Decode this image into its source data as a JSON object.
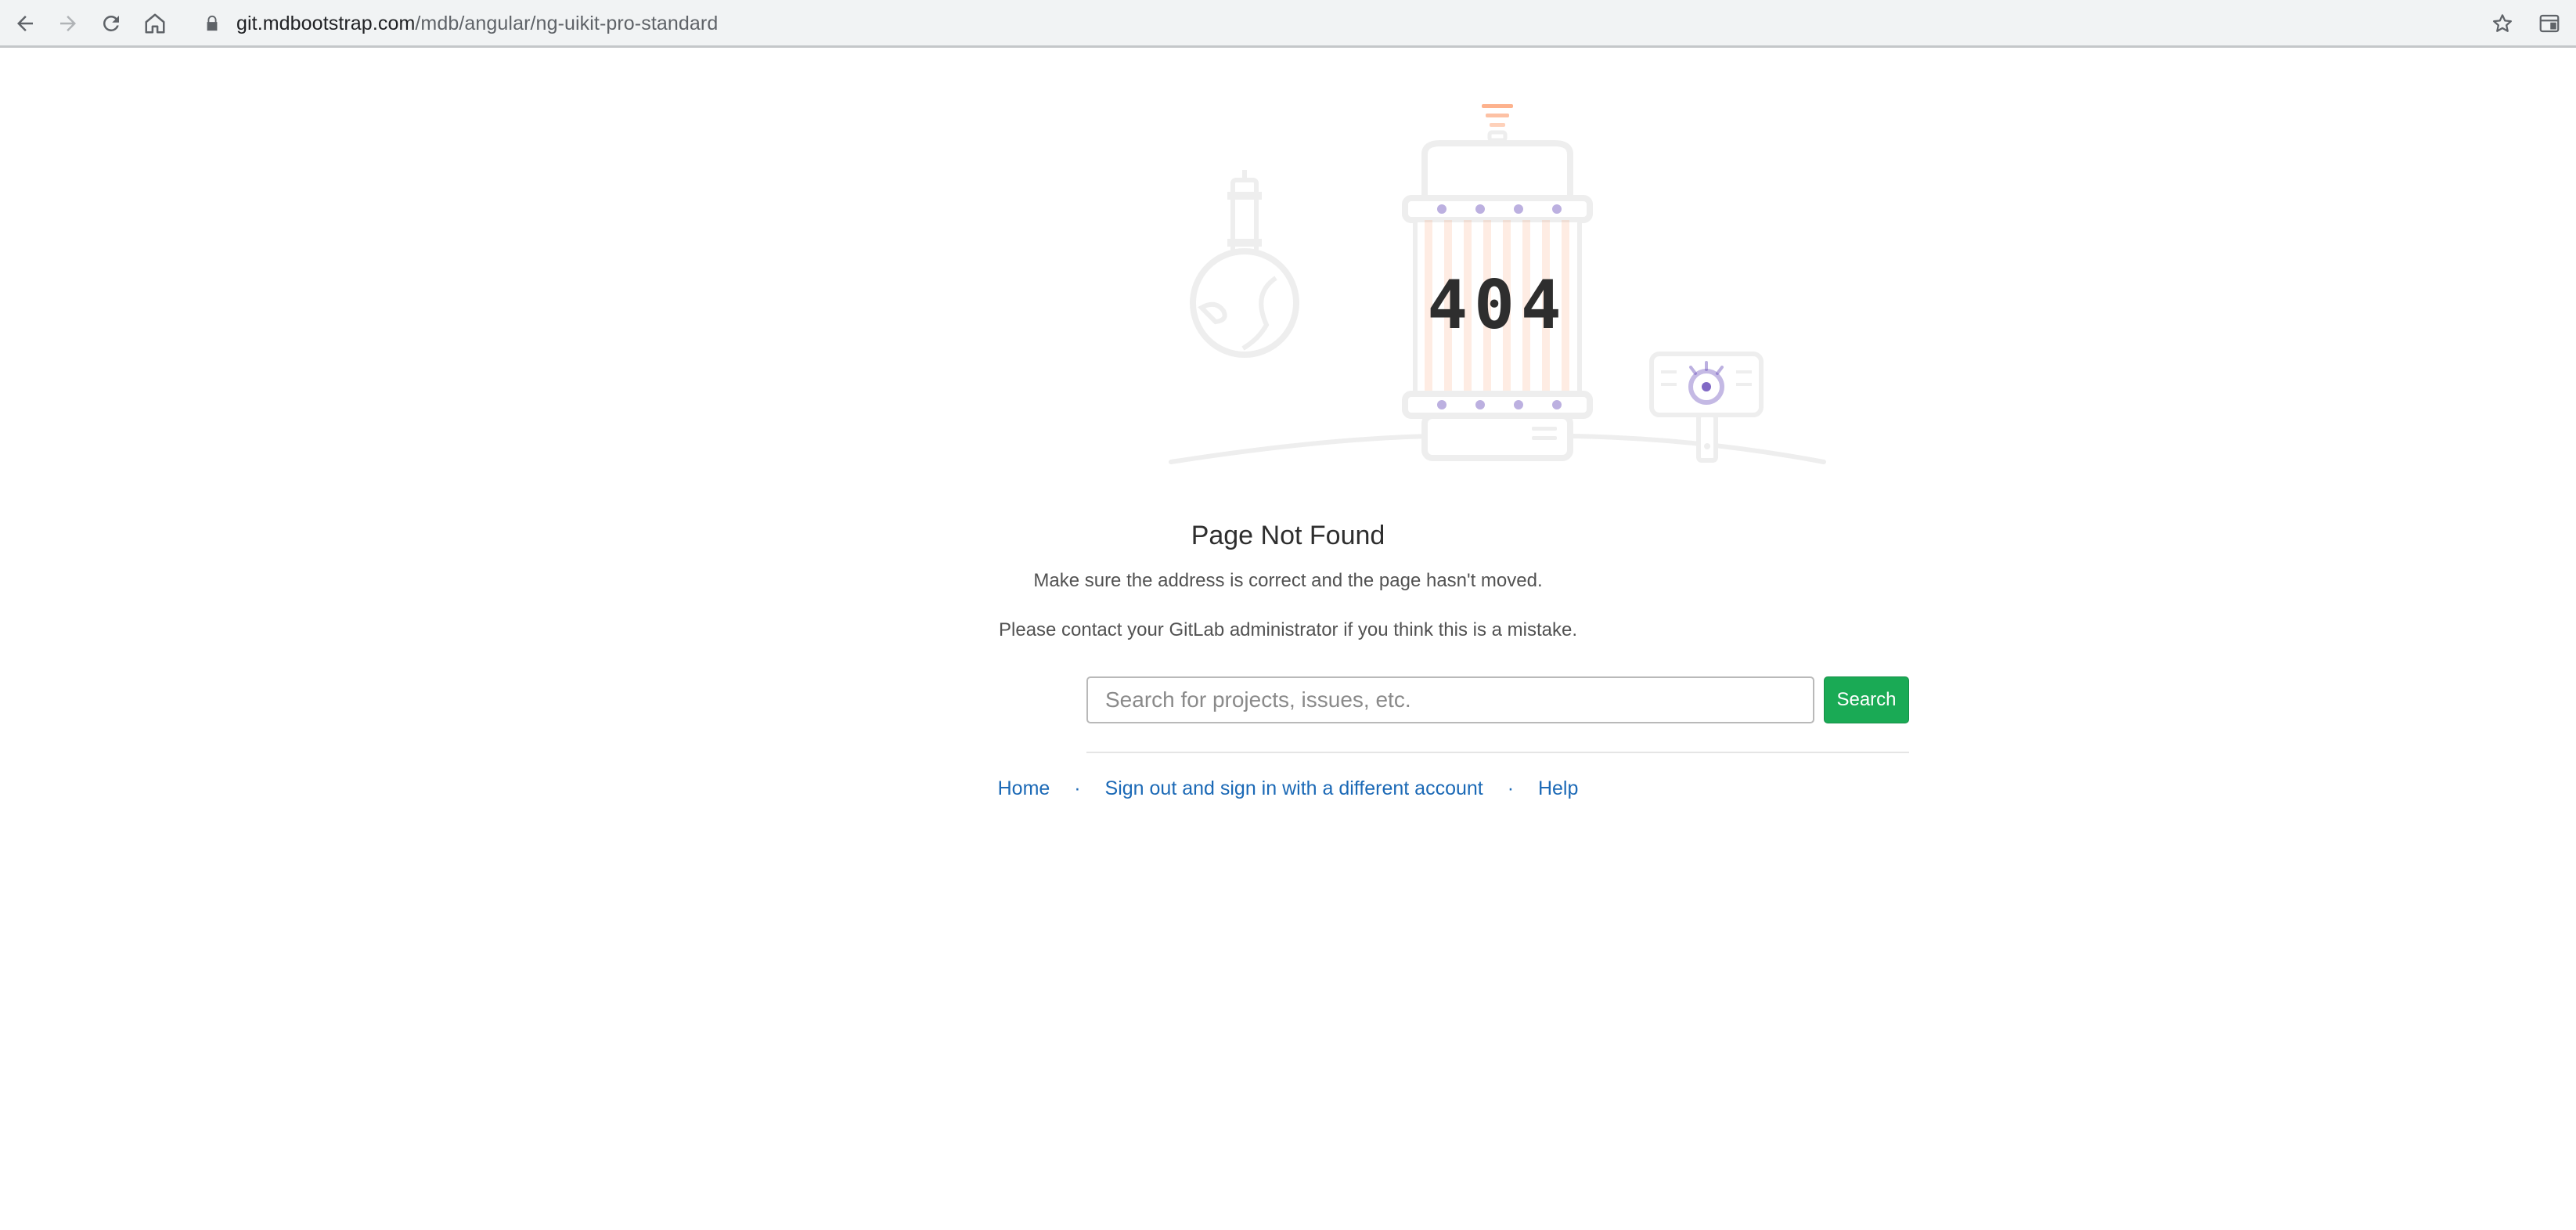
{
  "browser": {
    "url_host": "git.mdbootstrap.com",
    "url_path": "/mdb/angular/ng-uikit-pro-standard",
    "icons": {
      "back": "arrow-left-icon",
      "forward": "arrow-right-icon",
      "reload": "reload-icon",
      "home": "home-icon",
      "lock": "lock-icon",
      "bookmark": "star-icon",
      "extension": "window-icon"
    }
  },
  "illustration": {
    "code": "404"
  },
  "error": {
    "title": "Page Not Found",
    "message_1": "Make sure the address is correct and the page hasn't moved.",
    "message_2": "Please contact your GitLab administrator if you think this is a mistake."
  },
  "search": {
    "placeholder": "Search for projects, issues, etc.",
    "button_label": "Search"
  },
  "footer": {
    "home": "Home",
    "sign_out": "Sign out and sign in with a different account",
    "help": "Help",
    "separator": "·"
  },
  "colors": {
    "search_button": "#1aaa55",
    "link": "#1b69b6",
    "illustration_accent": "#fc9867",
    "illustration_purple": "#6b4fbb"
  }
}
